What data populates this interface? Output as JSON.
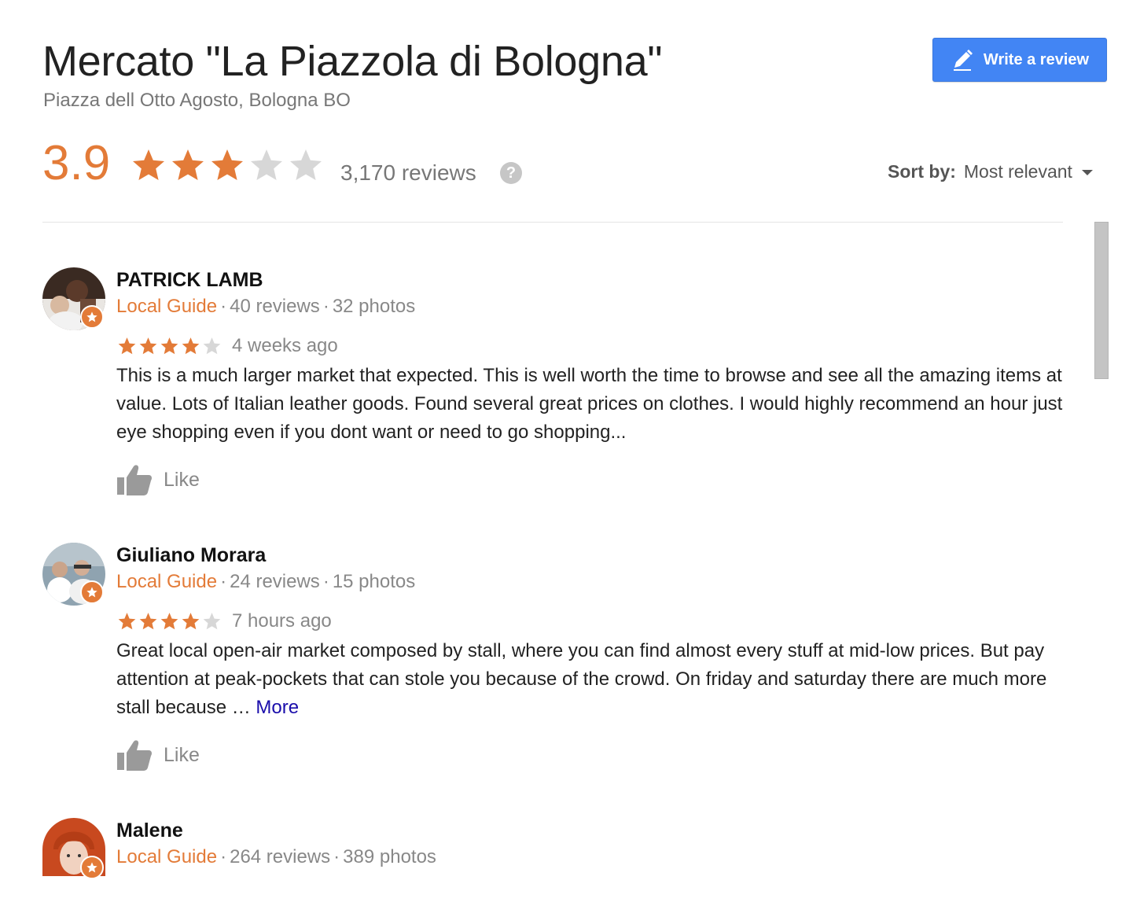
{
  "place": {
    "title": "Mercato \"La Piazzola di Bologna\"",
    "address": "Piazza dell Otto Agosto, Bologna BO",
    "rating": "3.9",
    "rating_value": 3.9,
    "rating_max": 5,
    "review_count": "3,170 reviews",
    "help_icon_glyph": "?"
  },
  "header": {
    "write_review_label": "Write a review",
    "write_review_icon": "pencil-icon"
  },
  "sort": {
    "label": "Sort by:",
    "value": "Most relevant"
  },
  "colors": {
    "accent_orange": "#e37b38",
    "star_empty": "#d7d7d7",
    "button_blue": "#4285f4",
    "link_blue": "#1a0dab"
  },
  "reviews": [
    {
      "name": "PATRICK LAMB",
      "guide": "Local Guide",
      "reviews_count": "40 reviews",
      "photos_count": "32 photos",
      "stars": 4,
      "time": "4 weeks ago",
      "text": "This is a much larger market that expected.  This is well worth the time to browse and see all the amazing items at value.  Lots of Italian leather goods.  Found several great prices on clothes. I would highly recommend an hour just eye shopping even if you dont want or need to go shopping...",
      "more": "",
      "like_label": "Like"
    },
    {
      "name": "Giuliano Morara",
      "guide": "Local Guide",
      "reviews_count": "24 reviews",
      "photos_count": "15 photos",
      "stars": 4,
      "time": "7 hours ago",
      "text": "Great local open-air market composed by stall, where you can find almost every stuff at mid-low prices. But pay attention at peak-pockets that can stole you because of the crowd. On friday and saturday there are much more stall because … ",
      "more": "More",
      "like_label": "Like"
    },
    {
      "name": "Malene",
      "guide": "Local Guide",
      "reviews_count": "264 reviews",
      "photos_count": "389 photos"
    }
  ]
}
